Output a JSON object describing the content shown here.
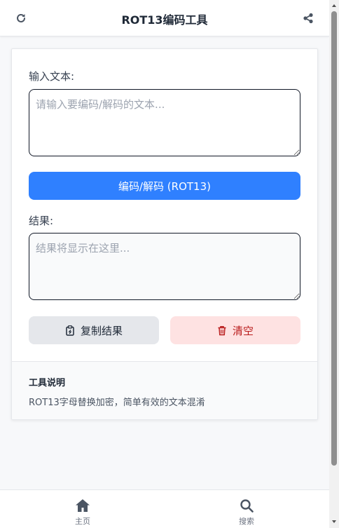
{
  "header": {
    "title": "ROT13编码工具",
    "refresh_icon": "refresh-icon",
    "share_icon": "share-icon"
  },
  "form": {
    "input_label": "输入文本:",
    "input_placeholder": "请输入要编码/解码的文本...",
    "input_value": "",
    "encode_button": "编码/解码 (ROT13)",
    "result_label": "结果:",
    "result_placeholder": "结果将显示在这里...",
    "result_value": "",
    "copy_button": "复制结果",
    "clear_button": "清空"
  },
  "info": {
    "title": "工具说明",
    "description": "ROT13字母替换加密，简单有效的文本混淆"
  },
  "bottom_nav": {
    "items": [
      {
        "label": "主页",
        "icon": "home-icon"
      },
      {
        "label": "搜索",
        "icon": "search-icon"
      }
    ]
  },
  "colors": {
    "primary": "#2f80ff",
    "danger_bg": "#fee2e2",
    "danger_text": "#b91c1c",
    "neutral_bg": "#e5e7eb"
  }
}
